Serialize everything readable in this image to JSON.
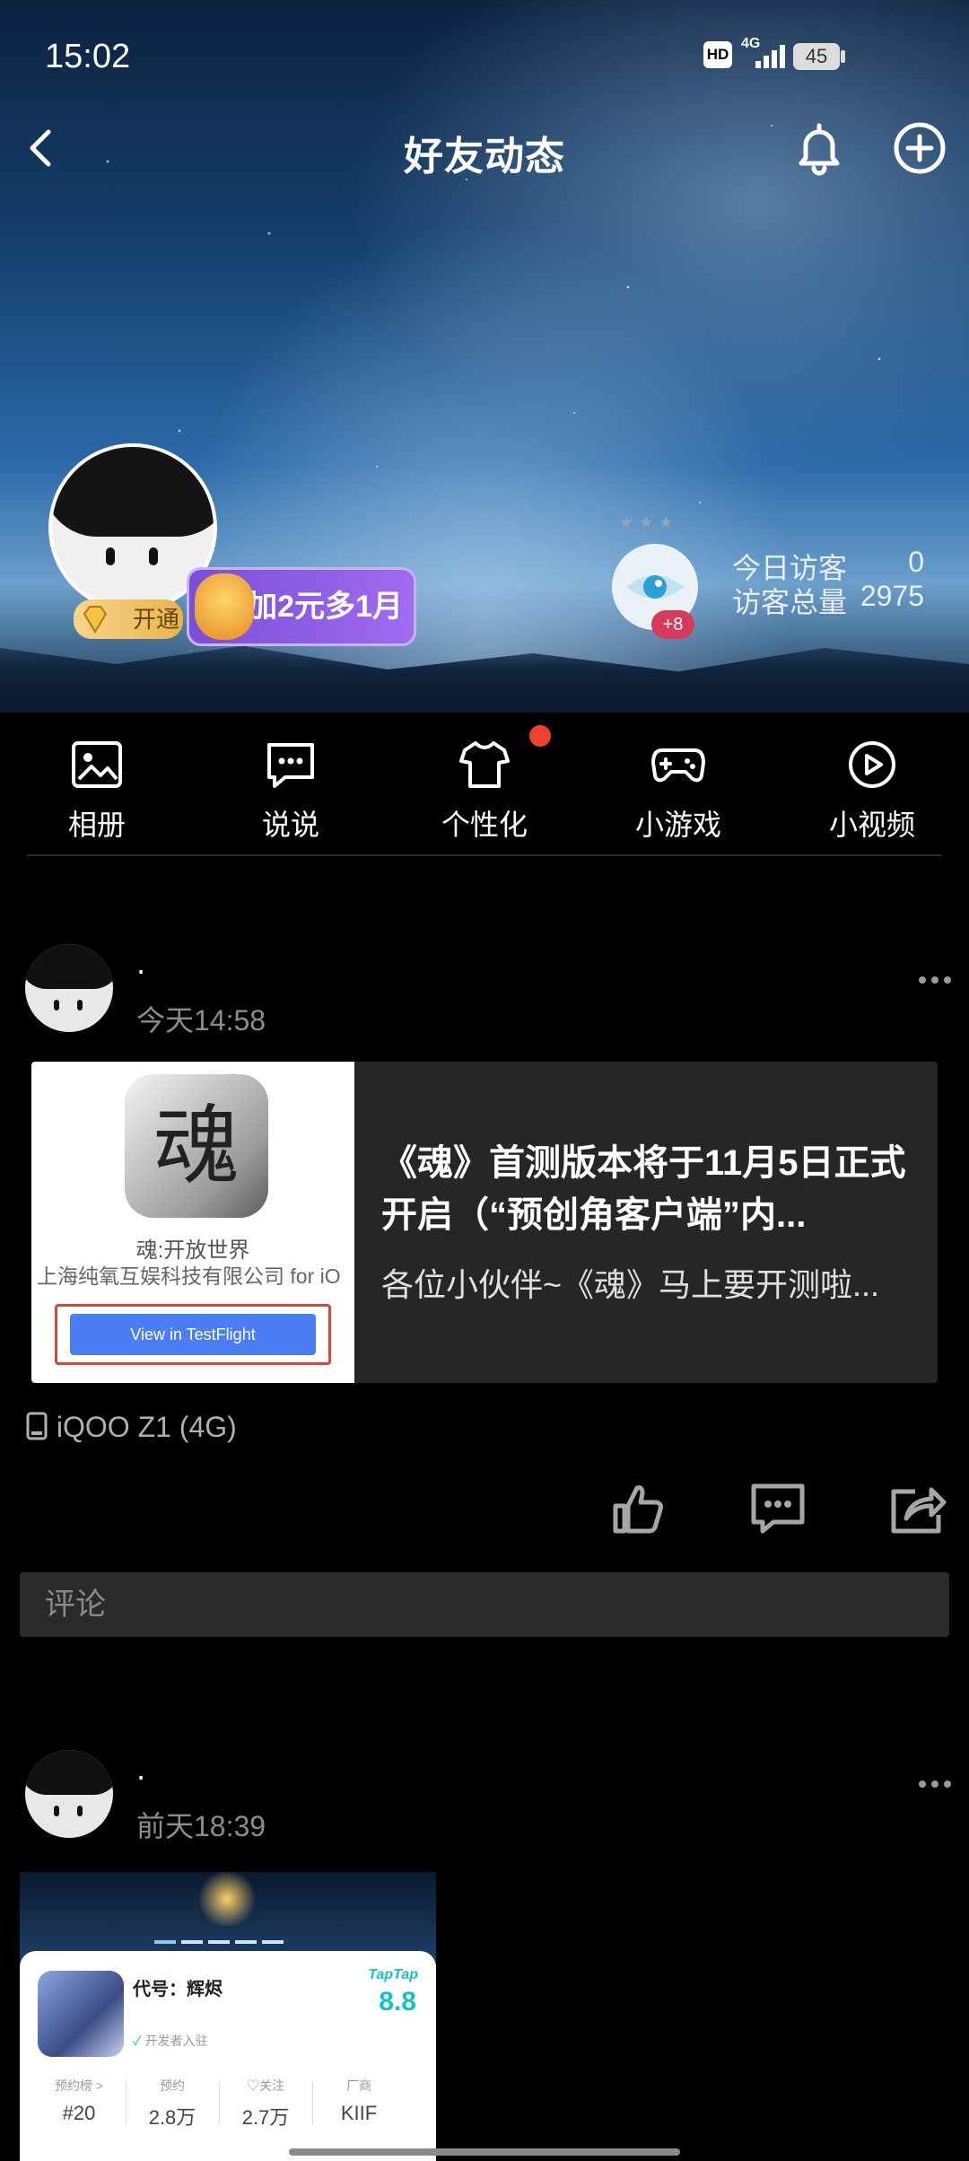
{
  "status_bar": {
    "time": "15:02",
    "network": "4G",
    "hd": "HD",
    "battery": "45"
  },
  "header": {
    "title": "好友动态"
  },
  "profile": {
    "vip_label": "开通",
    "promo_label": "加2元多1月",
    "visitor_badge": "+8",
    "today_visitors_label": "今日访客",
    "today_visitors_value": "0",
    "total_visitors_label": "访客总量",
    "total_visitors_value": "2975"
  },
  "tools": [
    {
      "label": "相册",
      "icon": "photo-icon"
    },
    {
      "label": "说说",
      "icon": "chat-bubble-icon"
    },
    {
      "label": "个性化",
      "icon": "tshirt-icon",
      "dot": true
    },
    {
      "label": "小游戏",
      "icon": "gamepad-icon"
    },
    {
      "label": "小视频",
      "icon": "play-circle-icon"
    }
  ],
  "posts": [
    {
      "name": "·",
      "time": "今天14:58",
      "card": {
        "thumb_app_glyph": "魂",
        "thumb_app_name": "魂:开放世界",
        "thumb_company": "上海纯氧互娱科技有限公司 for iO",
        "thumb_button": "View in TestFlight",
        "title": "《魂》首测版本将于11月5日正式开启（“预创角客户端”内...",
        "subtitle": "各位小伙伴~《魂》马上要开测啦..."
      },
      "device": "iQOO Z1 (4G)",
      "comment_placeholder": "评论"
    },
    {
      "name": "·",
      "time": "前天18:39",
      "taptap": {
        "game_name": "代号：辉烬",
        "brand": "TapTap",
        "score": "8.8",
        "verified": "开发者入驻",
        "stats": [
          {
            "label": "预约榜 >",
            "value": "#20"
          },
          {
            "label": "预约",
            "value": "2.8万"
          },
          {
            "label": "♡关注",
            "value": "2.7万"
          },
          {
            "label": "厂商",
            "value": "KIIF"
          }
        ]
      }
    }
  ],
  "colors": {
    "accent_red": "#f0412f",
    "background": "#000000",
    "card_bg": "#262626",
    "taptap_teal": "#16c1c8"
  }
}
